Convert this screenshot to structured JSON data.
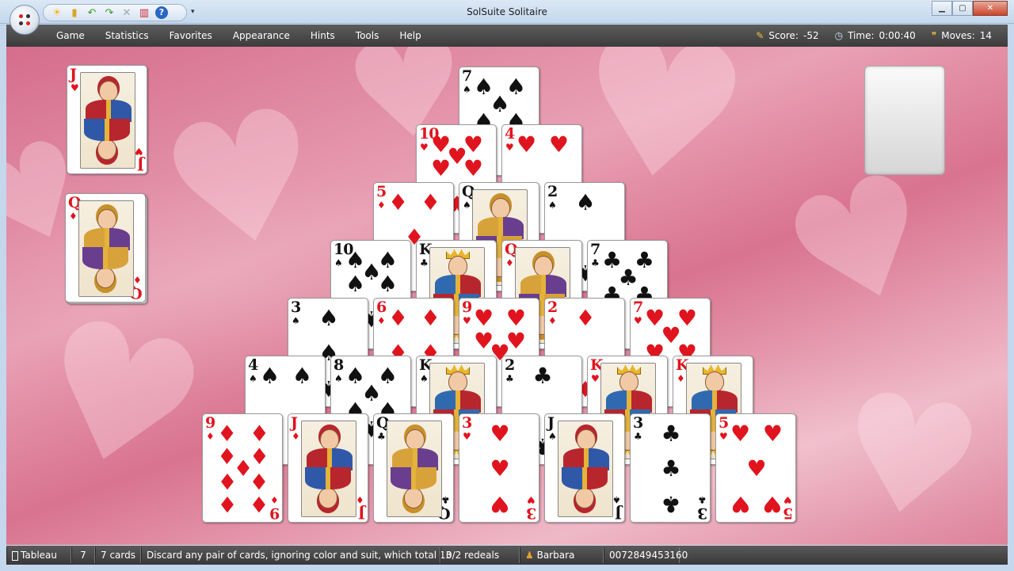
{
  "window": {
    "title": "SolSuite Solitaire"
  },
  "quick_access": {
    "icons": [
      "new-game-icon",
      "deal-icon",
      "undo-icon",
      "redo-icon",
      "cut-icon",
      "statistics-icon",
      "help-icon"
    ],
    "more": "▾"
  },
  "menu": {
    "items": [
      "Game",
      "Statistics",
      "Favorites",
      "Appearance",
      "Hints",
      "Tools",
      "Help"
    ]
  },
  "stats": {
    "score_label": "Score:",
    "score_value": "-52",
    "time_label": "Time:",
    "time_value": "0:00:40",
    "moves_label": "Moves:",
    "moves_value": "14"
  },
  "colors": {
    "card_red": "#e0141e",
    "card_black": "#111111",
    "felt_pink": "#d9738f",
    "menubar_dark": "#3b3b3b"
  },
  "cards": {
    "waste_top": {
      "rank": "J",
      "suit": "♥",
      "color": "red",
      "type": "face",
      "role": "waste"
    },
    "stock": {
      "rank": "Q",
      "suit": "♦",
      "color": "red",
      "type": "face",
      "role": "stock"
    },
    "pyramid": [
      [
        {
          "rank": "7",
          "suit": "♠",
          "color": "black"
        }
      ],
      [
        {
          "rank": "10",
          "suit": "♥",
          "color": "red"
        },
        {
          "rank": "4",
          "suit": "♥",
          "color": "red"
        }
      ],
      [
        {
          "rank": "5",
          "suit": "♦",
          "color": "red"
        },
        {
          "rank": "Q",
          "suit": "♠",
          "color": "black",
          "face": true
        },
        {
          "rank": "2",
          "suit": "♠",
          "color": "black"
        }
      ],
      [
        {
          "rank": "10",
          "suit": "♠",
          "color": "black"
        },
        {
          "rank": "K",
          "suit": "♣",
          "color": "black",
          "face": true
        },
        {
          "rank": "Q",
          "suit": "♦",
          "color": "red",
          "face": true
        },
        {
          "rank": "7",
          "suit": "♣",
          "color": "black"
        }
      ],
      [
        {
          "rank": "3",
          "suit": "♠",
          "color": "black"
        },
        {
          "rank": "6",
          "suit": "♦",
          "color": "red"
        },
        {
          "rank": "9",
          "suit": "♥",
          "color": "red"
        },
        {
          "rank": "2",
          "suit": "♦",
          "color": "red"
        },
        {
          "rank": "7",
          "suit": "♥",
          "color": "red"
        }
      ],
      [
        {
          "rank": "4",
          "suit": "♠",
          "color": "black"
        },
        {
          "rank": "8",
          "suit": "♠",
          "color": "black"
        },
        {
          "rank": "K",
          "suit": "♠",
          "color": "black",
          "face": true
        },
        {
          "rank": "2",
          "suit": "♣",
          "color": "black"
        },
        {
          "rank": "K",
          "suit": "♥",
          "color": "red",
          "face": true
        },
        {
          "rank": "K",
          "suit": "♦",
          "color": "red",
          "face": true
        }
      ],
      [
        {
          "rank": "9",
          "suit": "♦",
          "color": "red"
        },
        {
          "rank": "J",
          "suit": "♦",
          "color": "red",
          "face": true
        },
        {
          "rank": "Q",
          "suit": "♣",
          "color": "black",
          "face": true
        },
        {
          "rank": "3",
          "suit": "♥",
          "color": "red"
        },
        {
          "rank": "J",
          "suit": "♠",
          "color": "black",
          "face": true
        },
        {
          "rank": "3",
          "suit": "♣",
          "color": "black"
        },
        {
          "rank": "5",
          "suit": "♥",
          "color": "red"
        }
      ]
    ]
  },
  "status": {
    "game_name": "Tableau",
    "count": "7",
    "cards": "7 cards",
    "hint": "Discard any pair of cards, ignoring color and suit, which total 13",
    "redeals": "0/2 redeals",
    "player": "Barbara",
    "game_number": "0072849453160"
  }
}
